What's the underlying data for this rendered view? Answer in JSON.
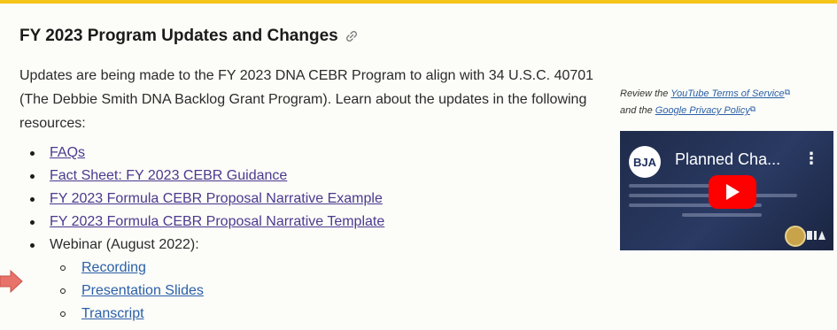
{
  "section": {
    "title": "FY 2023 Program Updates and Changes",
    "intro": "Updates are being made to the FY 2023 DNA CEBR Program to align with 34 U.S.C. 40701 (The Debbie Smith DNA Backlog Grant Program). Learn about the updates in the following resources:"
  },
  "resources": [
    {
      "label": "FAQs"
    },
    {
      "label": "Fact Sheet: FY 2023 CEBR Guidance"
    },
    {
      "label": "FY 2023 Formula CEBR Proposal Narrative Example"
    },
    {
      "label": "FY 2023 Formula CEBR Proposal Narrative Template"
    }
  ],
  "webinar": {
    "label": "Webinar (August 2022):",
    "items": [
      {
        "label": "Recording"
      },
      {
        "label": "Presentation Slides"
      },
      {
        "label": "Transcript"
      }
    ]
  },
  "sidebar": {
    "review_prefix": "Review the ",
    "tos_link": "YouTube Terms of Service",
    "and_the": "and the ",
    "privacy_link": "Google Privacy Policy"
  },
  "video": {
    "channel_badge": "BJA",
    "title": "Planned Cha...",
    "menu": "⋮"
  },
  "colors": {
    "accent_rule": "#f5c41b",
    "resource_link": "#4a3a8f",
    "sub_link": "#2a5fa8",
    "arrow": "#e8736b",
    "play_button": "#ff0000"
  },
  "icons": [
    "link-icon",
    "arrow-right-icon",
    "external-link-icon",
    "play-icon",
    "menu-dots-icon"
  ]
}
